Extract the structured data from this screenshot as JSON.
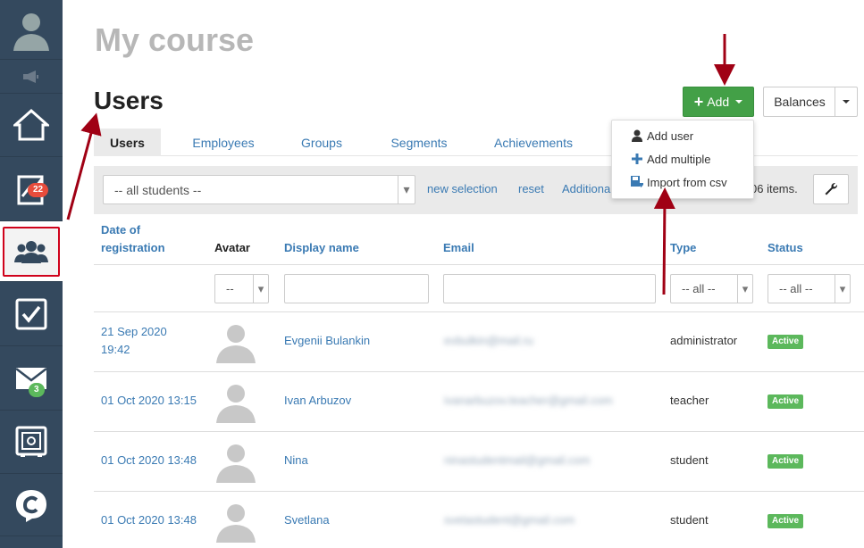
{
  "sidebar": {
    "items": [
      {
        "name": "user-avatar-icon"
      },
      {
        "name": "megaphone-icon"
      },
      {
        "name": "home-icon"
      },
      {
        "name": "chart-icon",
        "badge": "22"
      },
      {
        "name": "users-icon",
        "active": true
      },
      {
        "name": "checkbox-icon"
      },
      {
        "name": "mail-icon",
        "badge": "3"
      },
      {
        "name": "safe-icon"
      },
      {
        "name": "chat-logo-icon"
      }
    ]
  },
  "header": {
    "course_title": "My course",
    "page_title": "Users"
  },
  "actions": {
    "add_label": "Add",
    "balances_label": "Balances"
  },
  "add_menu": {
    "items": [
      {
        "label": "Add user",
        "icon": "user-icon"
      },
      {
        "label": "Add multiple",
        "icon": "plus-icon"
      },
      {
        "label": "Import from csv",
        "icon": "import-icon"
      }
    ]
  },
  "tabs": [
    {
      "label": "Users",
      "active": true
    },
    {
      "label": "Employees"
    },
    {
      "label": "Groups"
    },
    {
      "label": "Segments"
    },
    {
      "label": "Achievements"
    }
  ],
  "toolbar": {
    "selection_value": "-- all students --",
    "new_selection": "new selection",
    "reset": "reset",
    "additional": "Additiona",
    "items_count": "06 items."
  },
  "table": {
    "columns": {
      "date": "Date of registration",
      "avatar": "Avatar",
      "display_name": "Display name",
      "email": "Email",
      "type": "Type",
      "status": "Status"
    },
    "filters": {
      "avatar": "--",
      "type": "-- all --",
      "status": "-- all --"
    },
    "rows": [
      {
        "date": "21 Sep 2020 19:42",
        "name": "Evgenii Bulankin",
        "email": "evbulkin@mail.ru",
        "type": "administrator",
        "status": "Active"
      },
      {
        "date": "01 Oct 2020 13:15",
        "name": "Ivan Arbuzov",
        "email": "ivanarbuzov.teacher@gmail.com",
        "type": "teacher",
        "status": "Active"
      },
      {
        "date": "01 Oct 2020 13:48",
        "name": "Nina",
        "email": "ninastudentmail@gmail.com",
        "type": "student",
        "status": "Active"
      },
      {
        "date": "01 Oct 2020 13:48",
        "name": "Svetlana",
        "email": "svetastudent@gmail.com",
        "type": "student",
        "status": "Active"
      }
    ]
  },
  "colors": {
    "sidebar_bg": "#34495e",
    "accent_green": "#43a047",
    "link_blue": "#3a7ab3",
    "annotation_red": "#a00014",
    "badge_red": "#e74c3c",
    "badge_green": "#5cb85c"
  }
}
